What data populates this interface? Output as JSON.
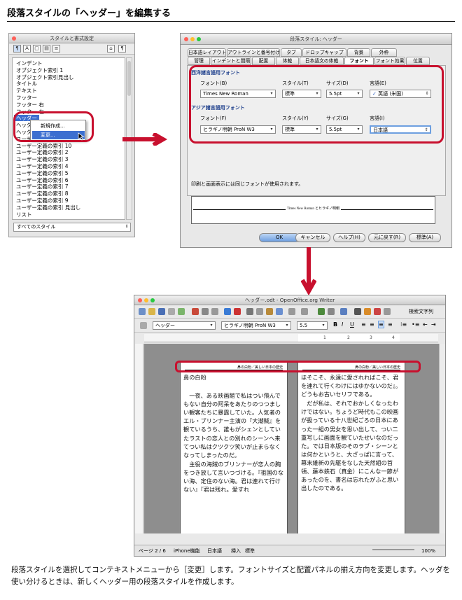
{
  "title": "段落スタイルの「ヘッダー」を編集する",
  "palette": {
    "title": "スタイルと書式設定",
    "items": [
      "インデント",
      "オブジェクト索引 1",
      "オブジェクト索引見出し",
      "タイトル",
      "テキスト",
      "フッター",
      "フッター 右",
      "フッター 左",
      "ヘッダー",
      "ヘッダ",
      "ヘッダ",
      "ユーザー定義の索引 1",
      "ユーザー定義の索引 10",
      "ユーザー定義の索引 2",
      "ユーザー定義の索引 3",
      "ユーザー定義の索引 4",
      "ユーザー定義の索引 5",
      "ユーザー定義の索引 6",
      "ユーザー定義の索引 7",
      "ユーザー定義の索引 8",
      "ユーザー定義の索引 9",
      "ユーザー定義の索引 見出し",
      "リスト"
    ],
    "context_menu": [
      "新規作成...",
      "変更..."
    ],
    "filter": "すべてのスタイル"
  },
  "dialog": {
    "title": "段落スタイル: ヘッダー",
    "tabs_row1": [
      "日本語レイアウト",
      "アウトラインと番号付け",
      "タブ",
      "ドロップキャップ",
      "背景",
      "外枠"
    ],
    "tabs_row2": [
      "管理",
      "インデントと間隔",
      "配置",
      "体裁",
      "日本語文の体裁",
      "フォント",
      "フォント効果",
      "位置"
    ],
    "western": {
      "section": "西洋諸言語用フォント",
      "font_label": "フォント(B)",
      "style_label": "スタイル(T)",
      "size_label": "サイズ(D)",
      "lang_label": "言語(E)",
      "font": "Times New Roman",
      "style": "標準",
      "size": "5.5pt",
      "lang": "英語 (米国)"
    },
    "asian": {
      "section": "アジア諸言語用フォント",
      "font_label": "フォント(F)",
      "style_label": "スタイル(Y)",
      "size_label": "サイズ(G)",
      "lang_label": "言語(I)",
      "font": "ヒラギノ明朝 ProN W3",
      "style": "標準",
      "size": "5.5pt",
      "lang": "日本語"
    },
    "note": "印刷と画面表示には同じフォントが使用されます。",
    "preview": "Times New Roman とヒラギノ明朝",
    "buttons": [
      "OK",
      "キャンセル",
      "ヘルプ(H)",
      "元に戻す(R)",
      "標準(A)"
    ]
  },
  "writer": {
    "title": "ヘッダー.odt - OpenOffice.org Writer",
    "search_label": "検索文字列",
    "para_style": "ヘッダー",
    "font": "ヒラギノ明朝 ProN W3",
    "size": "5.5",
    "ruler_marks": [
      "1",
      "2",
      "3",
      "4"
    ],
    "header_text": "鼻の白粉／美しい日本の歴史",
    "page1": [
      "鼻の白粉",
      "一夜、ある映画館で私はつい飛んでもない自分の阿呆をあたりのつつましい観客たちに暴露していた。人気者のエル・ブリンナー主演の『大潮賊』を観ているうち、誰もがシェンとしていたラストの恋人との別れのシーンへ来てつい私はクツクツ笑いが止まらなくなってしまったのだ。",
      "主役の海賊のブリンナーが恋人の胸をつき放して言いつづける。『祖国のない海、定住のない海。君は連れて行けない』『君は残れ。愛すれ"
    ],
    "page2": [
      "ほそこそ、永遠に愛されればこそ、君を連れて行くわけにはゆかないのだ』。どうもお古いセリフである。",
      "だが私は、それでおかしくなったわけではない。ちょうど時代もこの映画が扱っている十八世紀ごろの日本にあった一組の男女を思い出して、つい二重写しに画面を観ていたせいなのだった。では日本版のそのラブ・シーンとは何かというと、大ざっぱに言って、幕末維新の先駆をなした天然組の首領、藤本鉄石（真金）にこんな一節があったのを、書名は忘れたがふと思い出したのである。"
    ],
    "status": [
      "ページ 2 / 6",
      "iPhone機能",
      "日本語",
      "挿入",
      "標準"
    ],
    "zoom": "100%"
  },
  "caption": "段落スタイルを選択してコンテキストメニューから［変更］します。フォントサイズと配置パネルの揃え方向を変更します。ヘッダを使い分けるときは、新しくヘッダー用の段落スタイルを作成します。"
}
